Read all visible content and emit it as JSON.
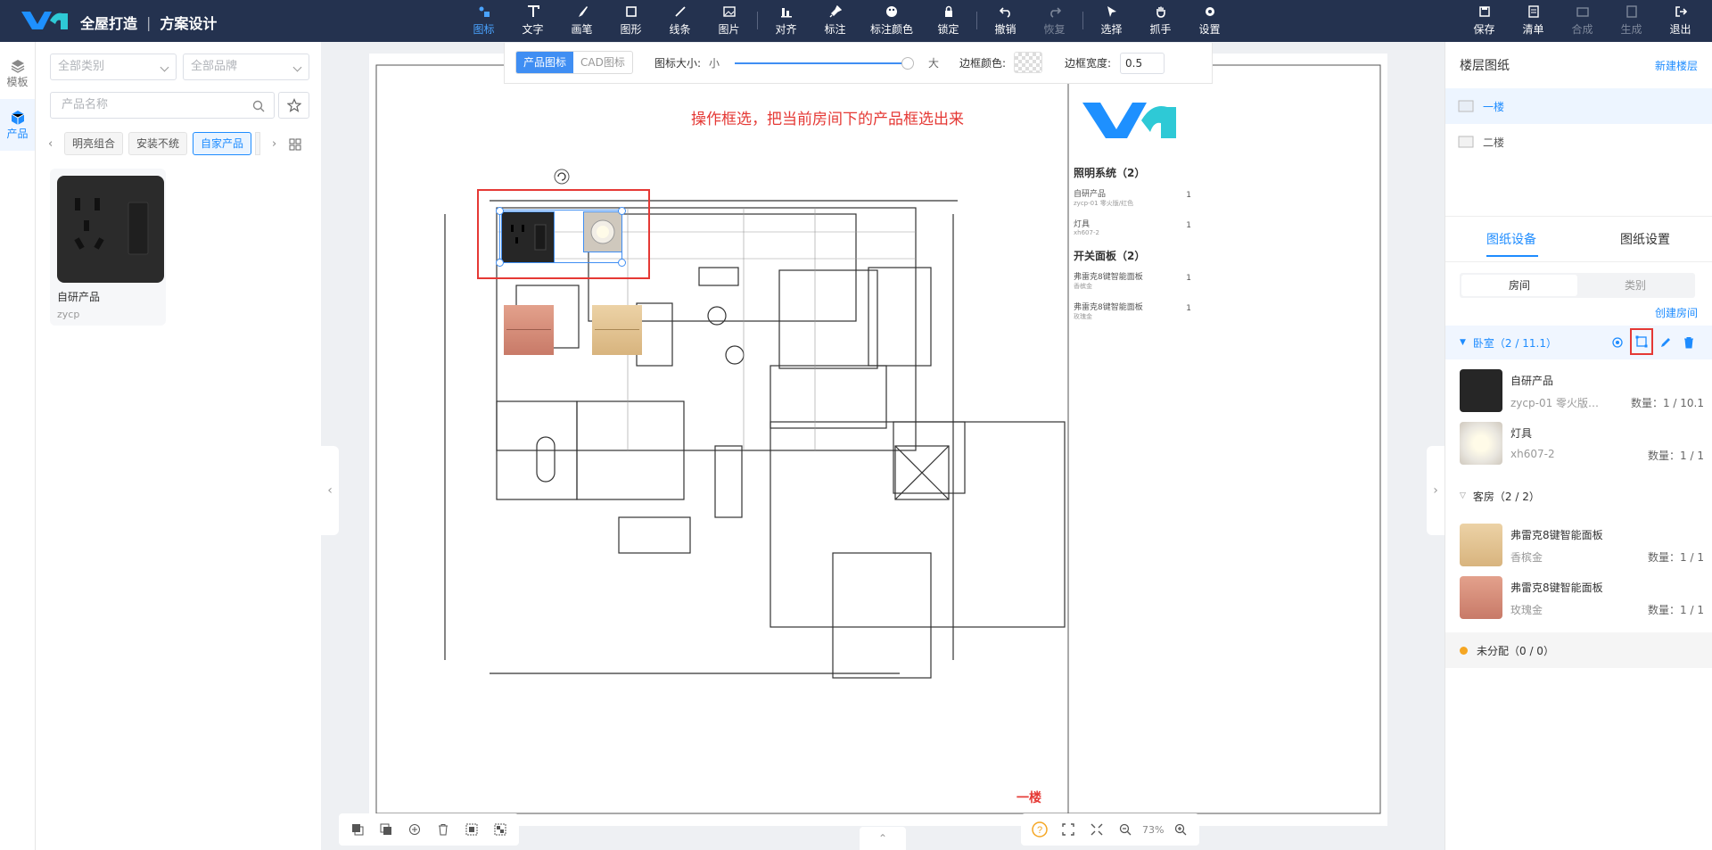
{
  "app": {
    "brand": "全屋打造",
    "section": "方案设计"
  },
  "toolbar": {
    "tools": [
      {
        "label": "图标",
        "icon": "icon-tool-icon",
        "active": true
      },
      {
        "label": "文字",
        "icon": "text-icon"
      },
      {
        "label": "画笔",
        "icon": "brush-icon"
      },
      {
        "label": "图形",
        "icon": "shape-icon"
      },
      {
        "label": "线条",
        "icon": "line-icon"
      },
      {
        "label": "图片",
        "icon": "image-icon"
      },
      {
        "label": "对齐",
        "icon": "align-icon"
      },
      {
        "label": "标注",
        "icon": "pin-icon"
      },
      {
        "label": "标注颜色",
        "icon": "palette-icon"
      },
      {
        "label": "锁定",
        "icon": "lock-icon"
      },
      {
        "label": "撤销",
        "icon": "undo-icon"
      },
      {
        "label": "恢复",
        "icon": "redo-icon",
        "disabled": true
      },
      {
        "label": "选择",
        "icon": "cursor-icon"
      },
      {
        "label": "抓手",
        "icon": "hand-icon"
      },
      {
        "label": "设置",
        "icon": "gear-icon"
      }
    ],
    "right": [
      {
        "label": "保存",
        "icon": "save-icon"
      },
      {
        "label": "清单",
        "icon": "list-icon"
      },
      {
        "label": "合成",
        "icon": "compose-icon",
        "disabled": true
      },
      {
        "label": "生成",
        "icon": "generate-icon",
        "disabled": true
      },
      {
        "label": "退出",
        "icon": "exit-icon"
      }
    ]
  },
  "leftstrip": {
    "template": "模板",
    "product": "产品"
  },
  "filters": {
    "category": "全部类别",
    "brand": "全部品牌",
    "search_placeholder": "产品名称",
    "chips": [
      "明亮组合",
      "安装不统",
      "自家产品"
    ]
  },
  "product_card": {
    "name": "自研产品",
    "code": "zycp"
  },
  "subtoolbar": {
    "seg_product": "产品图标",
    "seg_cad": "CAD图标",
    "size_label": "图标大小:",
    "size_small": "小",
    "size_large": "大",
    "border_color_label": "边框颜色:",
    "border_width_label": "边框宽度:",
    "border_width_value": "0.5",
    "size_level": 0.97
  },
  "canvas": {
    "annotation": "操作框选，把当前房间下的产品框选出来",
    "floor_label": "一楼",
    "legend": [
      {
        "group": "照明系统（2）",
        "items": [
          {
            "name": "自研产品",
            "sub": "zycp-01 零火版/红色",
            "qty": "1"
          },
          {
            "name": "灯具",
            "sub": "xh607-2",
            "qty": "1"
          }
        ]
      },
      {
        "group": "开关面板（2）",
        "items": [
          {
            "name": "弗雷克8键智能面板",
            "sub": "香槟金",
            "qty": "1"
          },
          {
            "name": "弗雷克8键智能面板",
            "sub": "玫瑰金",
            "qty": "1"
          }
        ]
      }
    ],
    "zoom": "73%"
  },
  "rightpanel": {
    "title": "楼层图纸",
    "new_floor": "新建楼层",
    "floors": [
      "一楼",
      "二楼"
    ],
    "tab_devices": "图纸设备",
    "tab_settings": "图纸设置",
    "toggle_room": "房间",
    "toggle_category": "类别",
    "create_room": "创建房间",
    "rooms": [
      {
        "name": "卧室（2 / 11.1）",
        "items": [
          {
            "name": "自研产品",
            "sub": "zycp-01 零火版/...",
            "qty": "数量：1 / 10.1"
          },
          {
            "name": "灯具",
            "sub": "xh607-2",
            "qty": "数量：1 / 1"
          }
        ]
      },
      {
        "name": "客房（2 / 2）",
        "items": [
          {
            "name": "弗雷克8键智能面板",
            "sub": "香槟金",
            "qty": "数量：1 / 1"
          },
          {
            "name": "弗雷克8键智能面板",
            "sub": "玫瑰金",
            "qty": "数量：1 / 1"
          }
        ]
      }
    ],
    "unassigned": "未分配（0 / 0）"
  },
  "colors": {
    "topbar": "#24324f",
    "accent": "#1e8cff",
    "annotation": "#e53935"
  }
}
